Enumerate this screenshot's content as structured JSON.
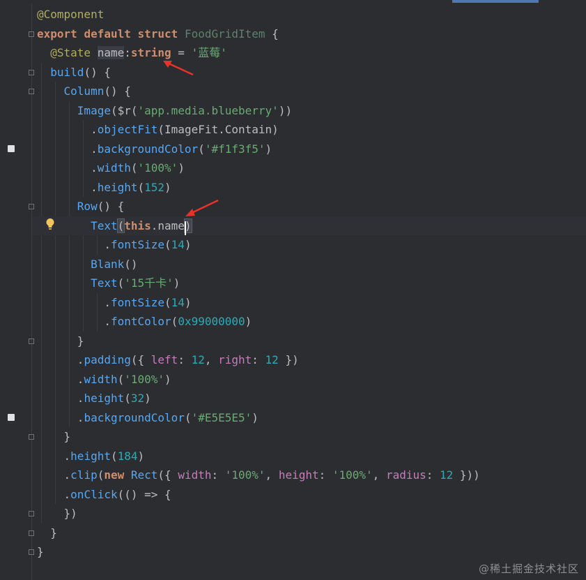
{
  "editor": {
    "language": "ArkTS",
    "lines": [
      {
        "segments": [
          [
            "anno",
            "@Component"
          ]
        ]
      },
      {
        "segments": [
          [
            "kw",
            "export "
          ],
          [
            "kw",
            "default "
          ],
          [
            "kw",
            "struct "
          ],
          [
            "cls",
            "FoodGridItem"
          ],
          [
            "plain",
            " {"
          ]
        ]
      },
      {
        "segments": [
          [
            "anno",
            "@State "
          ],
          [
            "plain",
            "name"
          ],
          [
            "plain",
            ":"
          ],
          [
            "kw",
            "string"
          ],
          [
            "plain",
            " = "
          ],
          [
            "str",
            "'蓝莓'"
          ]
        ]
      },
      {
        "segments": [
          [
            "fn",
            "build"
          ],
          [
            "plain",
            "() {"
          ]
        ]
      },
      {
        "segments": [
          [
            "fn",
            "Column"
          ],
          [
            "plain",
            "() {"
          ]
        ]
      },
      {
        "segments": [
          [
            "fn",
            "Image"
          ],
          [
            "plain",
            "("
          ],
          [
            "plain",
            "$r"
          ],
          [
            "plain",
            "("
          ],
          [
            "str",
            "'app.media.blueberry'"
          ],
          [
            "plain",
            "))"
          ]
        ]
      },
      {
        "segments": [
          [
            "plain",
            "."
          ],
          [
            "fn",
            "objectFit"
          ],
          [
            "plain",
            "(ImageFit.Contain)"
          ]
        ]
      },
      {
        "segments": [
          [
            "plain",
            "."
          ],
          [
            "fn",
            "backgroundColor"
          ],
          [
            "plain",
            "("
          ],
          [
            "str",
            "'#f1f3f5'"
          ],
          [
            "plain",
            ")"
          ]
        ]
      },
      {
        "segments": [
          [
            "plain",
            "."
          ],
          [
            "fn",
            "width"
          ],
          [
            "plain",
            "("
          ],
          [
            "str",
            "'100%'"
          ],
          [
            "plain",
            ")"
          ]
        ]
      },
      {
        "segments": [
          [
            "plain",
            "."
          ],
          [
            "fn",
            "height"
          ],
          [
            "plain",
            "("
          ],
          [
            "num",
            "152"
          ],
          [
            "plain",
            ")"
          ]
        ]
      },
      {
        "segments": [
          [
            "fn",
            "Row"
          ],
          [
            "plain",
            "() {"
          ]
        ]
      },
      {
        "segments": [
          [
            "fn",
            "Text"
          ],
          [
            "plain",
            "("
          ],
          [
            "kw",
            "this"
          ],
          [
            "plain",
            "."
          ],
          [
            "plain",
            "name"
          ],
          [
            "plain",
            ")"
          ]
        ]
      },
      {
        "segments": [
          [
            "plain",
            "."
          ],
          [
            "fn",
            "fontSize"
          ],
          [
            "plain",
            "("
          ],
          [
            "num",
            "14"
          ],
          [
            "plain",
            ")"
          ]
        ]
      },
      {
        "segments": [
          [
            "fn",
            "Blank"
          ],
          [
            "plain",
            "()"
          ]
        ]
      },
      {
        "segments": [
          [
            "fn",
            "Text"
          ],
          [
            "plain",
            "("
          ],
          [
            "str",
            "'15千卡'"
          ],
          [
            "plain",
            ")"
          ]
        ]
      },
      {
        "segments": [
          [
            "plain",
            "."
          ],
          [
            "fn",
            "fontSize"
          ],
          [
            "plain",
            "("
          ],
          [
            "num",
            "14"
          ],
          [
            "plain",
            ")"
          ]
        ]
      },
      {
        "segments": [
          [
            "plain",
            "."
          ],
          [
            "fn",
            "fontColor"
          ],
          [
            "plain",
            "("
          ],
          [
            "num",
            "0x99000000"
          ],
          [
            "plain",
            ")"
          ]
        ]
      },
      {
        "segments": [
          [
            "plain",
            "}"
          ]
        ]
      },
      {
        "segments": [
          [
            "plain",
            "."
          ],
          [
            "fn",
            "padding"
          ],
          [
            "plain",
            "({ "
          ],
          [
            "prop",
            "left"
          ],
          [
            "plain",
            ": "
          ],
          [
            "num",
            "12"
          ],
          [
            "plain",
            ", "
          ],
          [
            "prop",
            "right"
          ],
          [
            "plain",
            ": "
          ],
          [
            "num",
            "12"
          ],
          [
            "plain",
            " })"
          ]
        ]
      },
      {
        "segments": [
          [
            "plain",
            "."
          ],
          [
            "fn",
            "width"
          ],
          [
            "plain",
            "("
          ],
          [
            "str",
            "'100%'"
          ],
          [
            "plain",
            ")"
          ]
        ]
      },
      {
        "segments": [
          [
            "plain",
            "."
          ],
          [
            "fn",
            "height"
          ],
          [
            "plain",
            "("
          ],
          [
            "num",
            "32"
          ],
          [
            "plain",
            ")"
          ]
        ]
      },
      {
        "segments": [
          [
            "plain",
            "."
          ],
          [
            "fn",
            "backgroundColor"
          ],
          [
            "plain",
            "("
          ],
          [
            "str",
            "'#E5E5E5'"
          ],
          [
            "plain",
            ")"
          ]
        ]
      },
      {
        "segments": [
          [
            "plain",
            "}"
          ]
        ]
      },
      {
        "segments": [
          [
            "plain",
            "."
          ],
          [
            "fn",
            "height"
          ],
          [
            "plain",
            "("
          ],
          [
            "num",
            "184"
          ],
          [
            "plain",
            ")"
          ]
        ]
      },
      {
        "segments": [
          [
            "plain",
            "."
          ],
          [
            "fn",
            "clip"
          ],
          [
            "plain",
            "("
          ],
          [
            "kw",
            "new "
          ],
          [
            "fn",
            "Rect"
          ],
          [
            "plain",
            "({ "
          ],
          [
            "prop",
            "width"
          ],
          [
            "plain",
            ": "
          ],
          [
            "str",
            "'100%'"
          ],
          [
            "plain",
            ", "
          ],
          [
            "prop",
            "height"
          ],
          [
            "plain",
            ": "
          ],
          [
            "str",
            "'100%'"
          ],
          [
            "plain",
            ", "
          ],
          [
            "prop",
            "radius"
          ],
          [
            "plain",
            ": "
          ],
          [
            "num",
            "12"
          ],
          [
            "plain",
            " }))"
          ]
        ]
      },
      {
        "segments": [
          [
            "plain",
            "."
          ],
          [
            "fn",
            "onClick"
          ],
          [
            "plain",
            "(() => {"
          ]
        ]
      },
      {
        "segments": [
          [
            "plain",
            "})"
          ]
        ]
      },
      {
        "segments": [
          [
            "plain",
            "}"
          ]
        ]
      },
      {
        "segments": [
          [
            "plain",
            "}"
          ]
        ]
      }
    ],
    "indent": [
      0,
      0,
      1,
      1,
      2,
      3,
      4,
      4,
      4,
      4,
      3,
      4,
      5,
      4,
      4,
      5,
      5,
      3,
      3,
      3,
      3,
      3,
      2,
      2,
      2,
      2,
      2,
      1,
      0
    ],
    "active_line": 11
  },
  "watermark": "@稀土掘金技术社区",
  "colors": {
    "background": "#2b2d30",
    "keyword": "#cf8e6d",
    "annotation": "#b3ae60",
    "class": "#5f826b",
    "function": "#56a8f5",
    "string": "#6aab73",
    "number": "#2aacb8",
    "property": "#c77dbb",
    "arrow": "#e8322a"
  },
  "icons": [
    "lightbulb-icon",
    "fold-marker-icon",
    "gutter-mark-icon",
    "red-arrow-icon"
  ]
}
